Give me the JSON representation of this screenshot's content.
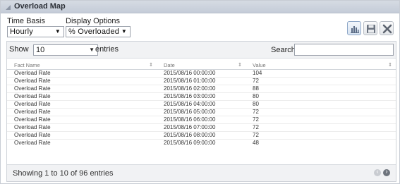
{
  "panel": {
    "title": "Overload Map"
  },
  "controls": {
    "time_basis": {
      "label": "Time Basis",
      "value": "Hourly"
    },
    "display_options": {
      "label": "Display Options",
      "value": "% Overloaded"
    }
  },
  "toolbar": {
    "chart_icon": "bar-chart-icon",
    "save_icon": "save-icon",
    "close_icon": "close-icon"
  },
  "datatable": {
    "show_label": "Show",
    "page_length": "10",
    "entries_label": "entries",
    "search_label": "Search:",
    "search_value": "",
    "columns": [
      "Fact Name",
      "Date",
      "Value"
    ],
    "rows": [
      [
        "Overload Rate",
        "2015/08/16 00:00:00",
        "104"
      ],
      [
        "Overload Rate",
        "2015/08/16 01:00:00",
        "72"
      ],
      [
        "Overload Rate",
        "2015/08/16 02:00:00",
        "88"
      ],
      [
        "Overload Rate",
        "2015/08/16 03:00:00",
        "80"
      ],
      [
        "Overload Rate",
        "2015/08/16 04:00:00",
        "80"
      ],
      [
        "Overload Rate",
        "2015/08/16 05:00:00",
        "72"
      ],
      [
        "Overload Rate",
        "2015/08/16 06:00:00",
        "72"
      ],
      [
        "Overload Rate",
        "2015/08/16 07:00:00",
        "72"
      ],
      [
        "Overload Rate",
        "2015/08/16 08:00:00",
        "72"
      ],
      [
        "Overload Rate",
        "2015/08/16 09:00:00",
        "48"
      ]
    ],
    "info": "Showing 1 to 10 of 96 entries"
  }
}
